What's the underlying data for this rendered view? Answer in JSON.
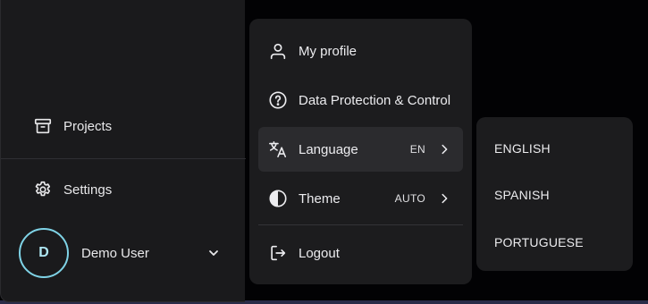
{
  "sidebar": {
    "items": [
      {
        "label": "Projects",
        "icon": "archive-icon"
      },
      {
        "label": "Settings",
        "icon": "gear-icon"
      }
    ],
    "user": {
      "initial": "D",
      "name": "Demo User",
      "icon": "chevron-down-icon"
    }
  },
  "user_menu": {
    "items": [
      {
        "label": "My profile",
        "icon": "user-icon"
      },
      {
        "label": "Data Protection & Control",
        "icon": "question-circle-icon"
      },
      {
        "label": "Language",
        "value": "EN",
        "icon": "translate-icon"
      },
      {
        "label": "Theme",
        "value": "AUTO",
        "icon": "contrast-icon"
      },
      {
        "label": "Logout",
        "icon": "logout-icon"
      }
    ]
  },
  "language_menu": {
    "options": [
      "ENGLISH",
      "SPANISH",
      "PORTUGUESE"
    ]
  },
  "colors": {
    "sidebar_bg": "#1a1a1c",
    "menu_bg": "#1c1c1e",
    "active_item_bg": "#2b2b2e",
    "avatar_ring": "#7fd3e6"
  }
}
